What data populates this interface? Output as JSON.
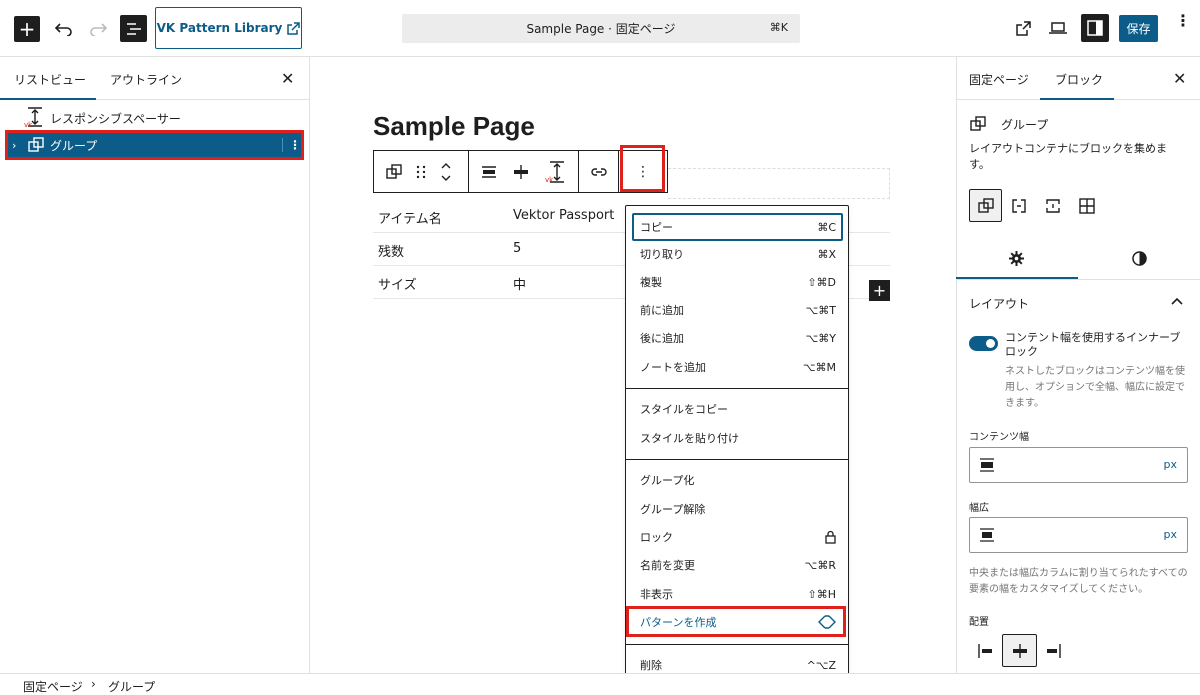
{
  "header": {
    "vk_button_label": "VK Pattern Library",
    "command_text": "Sample Page · 固定ページ",
    "command_shortcut": "⌘K",
    "save_label": "保存"
  },
  "list_view": {
    "tab_list": "リストビュー",
    "tab_outline": "アウトライン",
    "items": [
      {
        "label": "レスポンシブスペーサー"
      },
      {
        "label": "グループ"
      }
    ]
  },
  "canvas": {
    "page_title": "Sample Page",
    "table": [
      {
        "label": "アイテム名",
        "value": "Vektor Passport"
      },
      {
        "label": "残数",
        "value": "5"
      },
      {
        "label": "サイズ",
        "value": "中"
      }
    ]
  },
  "menu": {
    "group1": [
      {
        "label": "コピー",
        "shortcut": "⌘C"
      },
      {
        "label": "切り取り",
        "shortcut": "⌘X"
      },
      {
        "label": "複製",
        "shortcut": "⇧⌘D"
      },
      {
        "label": "前に追加",
        "shortcut": "⌥⌘T"
      },
      {
        "label": "後に追加",
        "shortcut": "⌥⌘Y"
      },
      {
        "label": "ノートを追加",
        "shortcut": "⌥⌘M"
      }
    ],
    "group2": [
      {
        "label": "スタイルをコピー"
      },
      {
        "label": "スタイルを貼り付け"
      }
    ],
    "group3": [
      {
        "label": "グループ化",
        "shortcut": ""
      },
      {
        "label": "グループ解除",
        "shortcut": ""
      },
      {
        "label": "ロック",
        "shortcut": ""
      },
      {
        "label": "名前を変更",
        "shortcut": "⌥⌘R"
      },
      {
        "label": "非表示",
        "shortcut": "⇧⌘H"
      },
      {
        "label": "パターンを作成",
        "shortcut": ""
      }
    ],
    "delete": {
      "label": "削除",
      "shortcut": "^⌥Z"
    }
  },
  "inspector": {
    "tab_page": "固定ページ",
    "tab_block": "ブロック",
    "block_name": "グループ",
    "block_desc": "レイアウトコンテナにブロックを集めます。",
    "layout_title": "レイアウト",
    "toggle_label": "コンテント幅を使用するインナーブロック",
    "toggle_help": "ネストしたブロックはコンテンツ幅を使用し、オプションで全幅、幅広に設定できます。",
    "content_width_label": "コンテンツ幅",
    "wide_width_label": "幅広",
    "unit": "px",
    "width_help": "中央または幅広カラムに割り当てられたすべての要素の幅をカスタマイズしてください。",
    "justification_label": "配置"
  },
  "footer": {
    "crumb_1": "固定ページ",
    "crumb_sep": "›",
    "crumb_2": "グループ"
  },
  "colors": {
    "accent": "#0b5c89",
    "highlight": "#e0201b",
    "text": "#1e1e1e"
  }
}
